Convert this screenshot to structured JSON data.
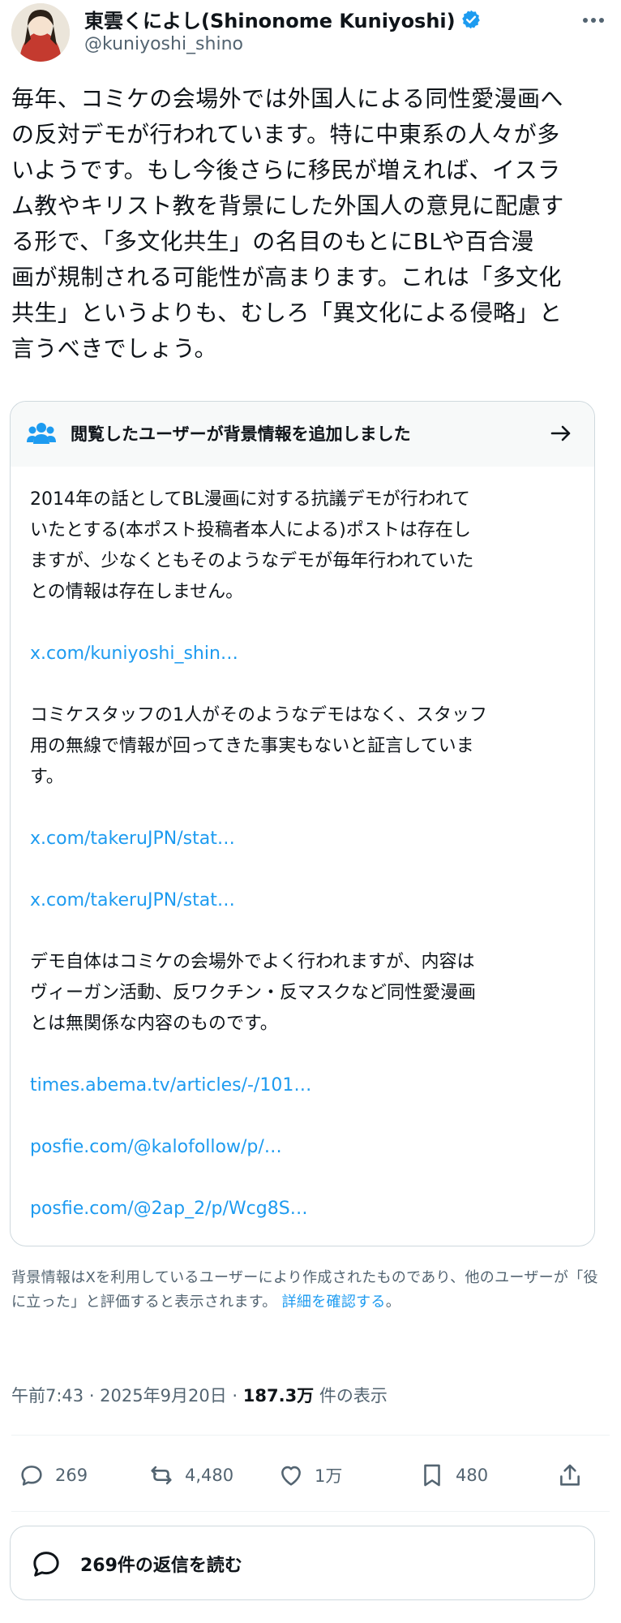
{
  "post": {
    "display_name": "東雲くによし(Shinonome Kuniyoshi)",
    "handle": "@kuniyoshi_shino",
    "text": "毎年、コミケの会場外では外国人による同性愛漫画へ\nの反対デモが行われています。特に中東系の人々が多\nいようです。もし今後さらに移民が増えれば、イスラ\nム教やキリスト教を背景にした外国人の意見に配慮す\nる形で、「多文化共生」の名目のもとにBLや百合漫\n画が規制される可能性が高まります。これは「多文化\n共生」というよりも、むしろ「異文化による侵略」と\n言うべきでしょう。"
  },
  "community_note": {
    "title": "閲覧したユーザーが背景情報を追加しました",
    "paragraphs": [
      "2014年の話としてBL漫画に対する抗議デモが行われて\nいたとする(本ポスト投稿者本人による)ポストは存在し\nますが、少なくともそのようなデモが毎年行われていた\nとの情報は存在しません。",
      "コミケスタッフの1人がそのようなデモはなく、スタッフ\n用の無線で情報が回ってきた事実もないと証言していま\nす。",
      "デモ自体はコミケの会場外でよく行われますが、内容は\nヴィーガン活動、反ワクチン・反マスクなど同性愛漫画\nとは無関係な内容のものです。"
    ],
    "links": [
      "x.com/kuniyoshi_shin…",
      "x.com/takeruJPN/stat…",
      "x.com/takeruJPN/stat…",
      "times.abema.tv/articles/-/101…",
      "posfie.com/@kalofollow/p/…",
      "posfie.com/@2ap_2/p/Wcg8S…"
    ]
  },
  "disclaimer": {
    "text": "背景情報はXを利用しているユーザーにより作成されたものであり、他のユーザーが「役に立った」と評価すると表示されます。 ",
    "link": "詳細を確認する",
    "suffix": "。"
  },
  "meta": {
    "time": "午前7:43 · 2025年9月20日 · ",
    "views": "187.3万",
    "views_label": " 件の表示"
  },
  "actions": {
    "replies": "269",
    "reposts": "4,480",
    "likes": "1万",
    "bookmarks": "480"
  },
  "read_replies_label": "269件の返信を読む",
  "colors": {
    "accent": "#1d9bf0",
    "secondary_text": "#536471",
    "border": "#cfd9de"
  },
  "icons": [
    "verified-badge-icon",
    "more-icon",
    "people-icon",
    "arrow-right-icon",
    "reply-icon",
    "repost-icon",
    "like-icon",
    "bookmark-icon",
    "share-icon",
    "chat-bubble-icon"
  ]
}
